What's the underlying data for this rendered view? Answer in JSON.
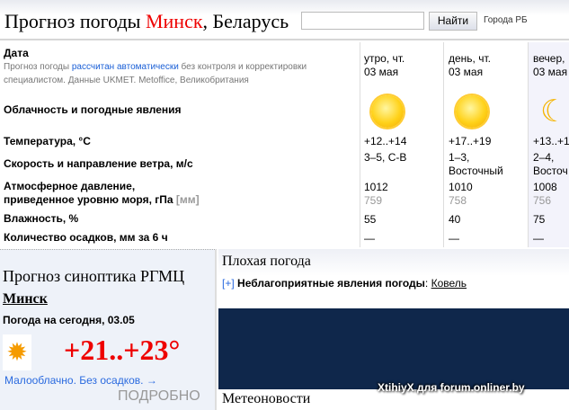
{
  "header": {
    "title_prefix": "Прогноз погоды ",
    "city": "Минск",
    "title_suffix": ", Беларусь",
    "search_value": "",
    "search_button": "Найти",
    "cities_link": "Города РБ"
  },
  "table": {
    "date_label": "Дата",
    "note_prefix": "Прогноз погоды ",
    "note_link": "рассчитан автоматически",
    "note_suffix": " без контроля и корректировки специалистом. Данные UKMET. Metoffice, Великобритания",
    "rows": {
      "cloud": "Облачность и погодные явления",
      "temp": "Температура, °C",
      "wind": "Скорость и направление ветра, м/с",
      "pressure1": "Атмосферное давление,",
      "pressure2": "приведенное уровню моря, гПа",
      "pressure_unit": "[мм]",
      "humidity": "Влажность, %",
      "precip": "Количество осадков, мм за 6 ч"
    },
    "columns": [
      {
        "period": "утро, чт.",
        "date": "03 мая",
        "icon": "sun-icon",
        "temp": "+12..+14",
        "wind1": "3–5, С-В",
        "wind2": "",
        "hpa": "1012",
        "mm": "759",
        "humidity": "55",
        "precip": "—"
      },
      {
        "period": "день, чт.",
        "date": "03 мая",
        "icon": "sun-icon",
        "temp": "+17..+19",
        "wind1": "1–3,",
        "wind2": "Восточный",
        "hpa": "1010",
        "mm": "758",
        "humidity": "40",
        "precip": "—"
      },
      {
        "period": "вечер,",
        "date": "03 мая",
        "icon": "moon-icon",
        "temp": "+13..+1",
        "wind1": "2–4,",
        "wind2": "Восточ",
        "hpa": "1008",
        "mm": "756",
        "humidity": "75",
        "precip": "—"
      }
    ]
  },
  "synoptic": {
    "title": "Прогноз синоптика РГМЦ",
    "city": "Минск",
    "today": "Погода на сегодня, 03.05",
    "temp": "+21..+23°",
    "desc": "Малооблачно. Без осадков. →",
    "more": "ПОДРОБНО"
  },
  "bad_weather": {
    "title": "Плохая погода",
    "toggle": "[+]",
    "label": "Неблагоприятные явления погоды",
    "colon": ":",
    "link": "Ковель"
  },
  "meteonews": {
    "title": "Метеоновости"
  },
  "watermark": "XtihiyX для forum.onliner.by"
}
